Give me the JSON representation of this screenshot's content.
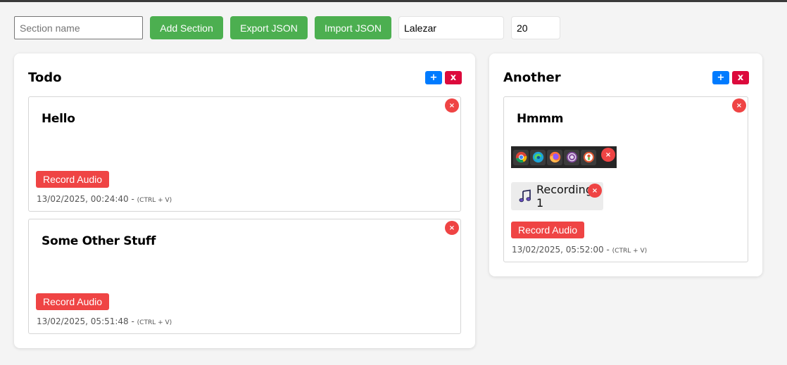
{
  "toolbar": {
    "section_name_placeholder": "Section name",
    "add_section_label": "Add Section",
    "export_label": "Export JSON",
    "import_label": "Import JSON",
    "font_value": "Lalezar",
    "size_value": "20"
  },
  "colors": {
    "green": "#4caf50",
    "red": "#ef4444",
    "blue": "#007bff",
    "crimson": "#dc0a3c"
  },
  "sections": [
    {
      "title": "Todo",
      "add_label": "+",
      "delete_label": "x",
      "notes": [
        {
          "title": "Hello",
          "close_label": "×",
          "record_label": "Record Audio",
          "timestamp": "13/02/2025, 00:24:40 -",
          "hint": "(CTRL + V)"
        },
        {
          "title": "Some Other Stuff",
          "close_label": "×",
          "record_label": "Record Audio",
          "timestamp": "13/02/2025, 05:51:48 -",
          "hint": "(CTRL + V)"
        }
      ]
    },
    {
      "title": "Another",
      "add_label": "+",
      "delete_label": "x",
      "notes": [
        {
          "title": "Hmmm",
          "close_label": "×",
          "image_close_label": "×",
          "image_icons": [
            "chrome-icon",
            "edge-icon",
            "firefox-icon",
            "tor-browser-icon",
            "duckduckgo-icon"
          ],
          "audio_label": "Recording 1",
          "audio_close_label": "×",
          "record_label": "Record Audio",
          "timestamp": "13/02/2025, 05:52:00 -",
          "hint": "(CTRL + V)"
        }
      ]
    }
  ]
}
